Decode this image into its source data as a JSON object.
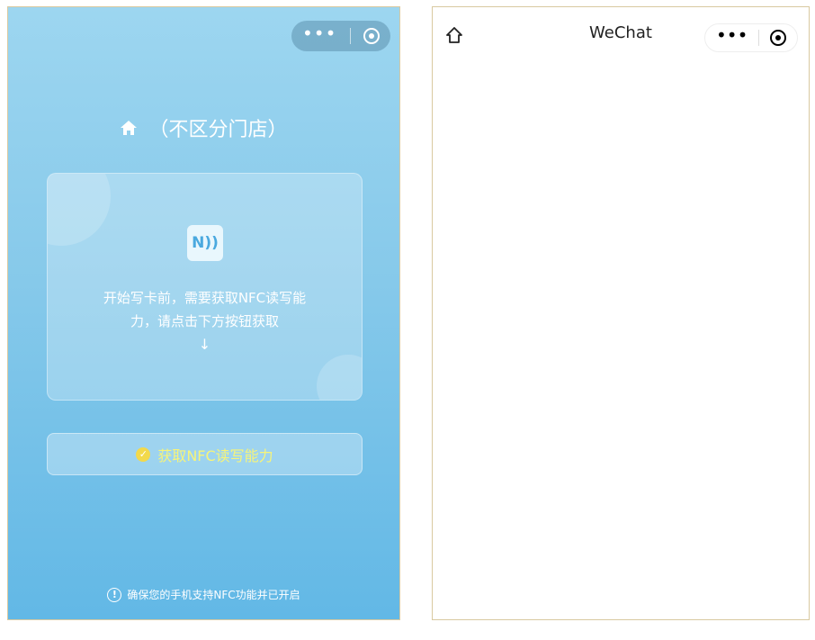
{
  "left_screen": {
    "store_title": "（不区分门店）",
    "card": {
      "nfc_icon_text": "N))",
      "text_line1": "开始写卡前，需要获取NFC读写能",
      "text_line2": "力，请点击下方按钮获取",
      "arrow": "↓"
    },
    "nfc_button_label": "获取NFC读写能力",
    "bottom_tip": "确保您的手机支持NFC功能并已开启",
    "colors": {
      "accent_yellow": "#f6f47a",
      "bg_top": "#9dd6f0",
      "bg_bottom": "#62b8e6"
    }
  },
  "right_screen": {
    "nav_title": "WeChat"
  },
  "capsule": {
    "more_glyph": "•••"
  }
}
